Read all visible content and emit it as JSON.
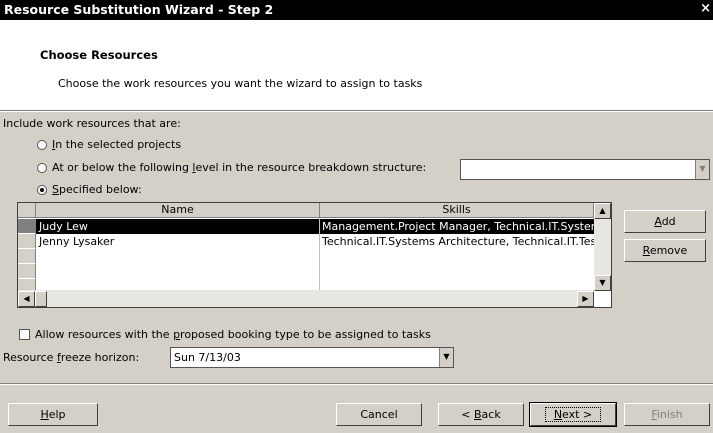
{
  "window": {
    "title": "Resource Substitution Wizard - Step 2",
    "close_glyph": "×"
  },
  "header": {
    "heading": "Choose Resources",
    "description": "Choose the work resources you want the wizard to assign to tasks"
  },
  "include": {
    "label": "Include work resources that are:",
    "options": [
      {
        "pre": "",
        "key": "I",
        "post": "n the selected projects",
        "selected": false
      },
      {
        "pre": "At or below the following ",
        "key": "l",
        "post": "evel in the resource breakdown structure:",
        "selected": false
      },
      {
        "pre": "",
        "key": "S",
        "post": "pecified below:",
        "selected": true
      }
    ],
    "rbs_value": ""
  },
  "table": {
    "columns": [
      "Name",
      "Skills"
    ],
    "rows": [
      {
        "name": "Judy Lew",
        "skills": "Management.Project Manager, Technical.IT.Systems",
        "selected": true
      },
      {
        "name": "Jenny Lysaker",
        "skills": "Technical.IT.Systems Architecture, Technical.IT.Testi",
        "selected": false
      }
    ]
  },
  "side_buttons": {
    "add": {
      "pre": "",
      "key": "A",
      "post": "dd"
    },
    "remove": {
      "pre": "",
      "key": "R",
      "post": "emove"
    }
  },
  "allow": {
    "pre": "Allow resources with the ",
    "key": "p",
    "post": "roposed booking type to be assigned to tasks",
    "checked": false
  },
  "freeze": {
    "pre": "Resource ",
    "key": "f",
    "post": "reeze horizon:",
    "value": "Sun 7/13/03"
  },
  "footer": {
    "help": {
      "pre": "",
      "key": "H",
      "post": "elp"
    },
    "cancel": "Cancel",
    "back": {
      "pre": "< ",
      "key": "B",
      "post": "ack"
    },
    "next": {
      "pre": "",
      "key": "N",
      "post": "ext >"
    },
    "finish": {
      "pre": "",
      "key": "F",
      "post": "inish"
    }
  },
  "icons": {
    "dropdown": "▼",
    "up": "▲",
    "down": "▼",
    "left": "◀",
    "right": "▶"
  },
  "colors": {
    "title_bg": "#000000",
    "dialog_bg": "#d4d0c8",
    "selection": "#000000"
  }
}
